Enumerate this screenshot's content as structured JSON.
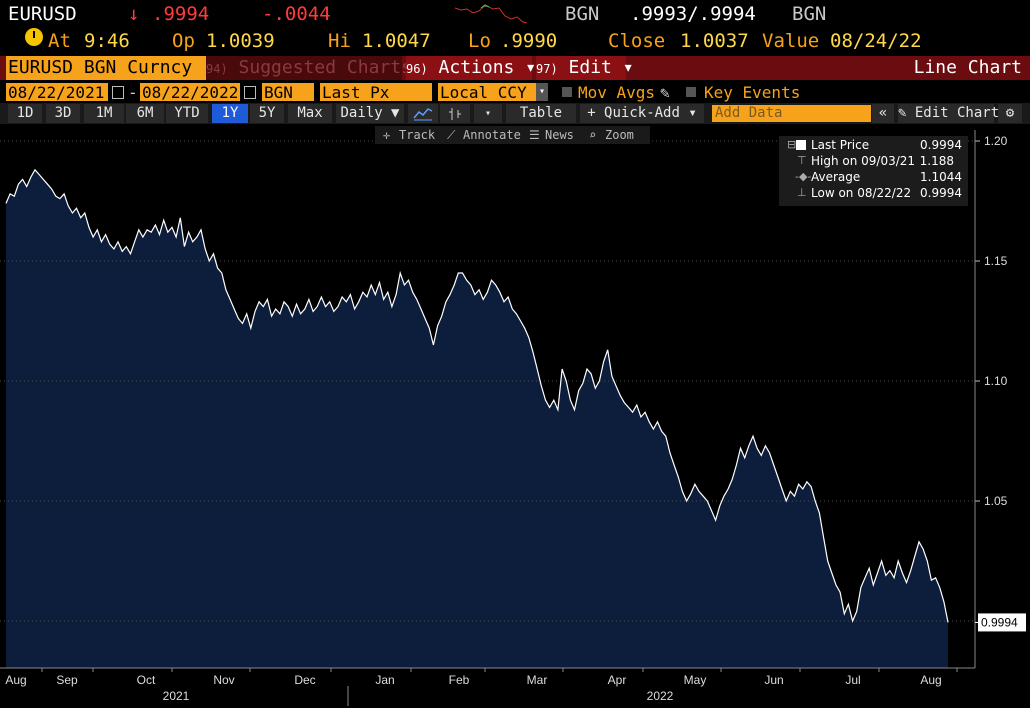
{
  "ticker": {
    "symbol": "EURUSD",
    "arrow": "↓",
    "price": ".9994",
    "change": "-.0044",
    "source": "BGN",
    "bid_ask": ".9993/.9994",
    "source2": "BGN"
  },
  "quote_line": {
    "at_label": "At",
    "time": "9:46",
    "op_label": "Op",
    "open": "1.0039",
    "hi_label": "Hi",
    "high": "1.0047",
    "lo_label": "Lo",
    "low": ".9990",
    "close_label": "Close",
    "close": "1.0037",
    "value_label": "Value",
    "value_date": "08/24/22"
  },
  "command_bar": {
    "security": "EURUSD BGN Curncy",
    "suggested_num": "94)",
    "suggested_label": "Suggested Charts",
    "actions_num": "96)",
    "actions_label": "Actions ▾",
    "edit_num": "97)",
    "edit_label": "Edit ▾",
    "chart_type": "Line Chart"
  },
  "settings": {
    "start_date": "08/22/2021",
    "dash": "-",
    "end_date": "08/22/2022",
    "source": "BGN",
    "field": "Last Px",
    "currency": "Local CCY",
    "mov_avgs": "Mov Avgs",
    "key_events": "Key Events"
  },
  "toolbar": {
    "periods": [
      "1D",
      "3D",
      "1M",
      "6M",
      "YTD",
      "1Y",
      "5Y",
      "Max"
    ],
    "selected_period": "1Y",
    "frequency": "Daily ▼",
    "table": "Table",
    "quick_add": "+ Quick-Add ▾",
    "add_data_placeholder": "Add Data",
    "collapse": "«",
    "edit_chart": "✎ Edit Chart",
    "gear": "⚙"
  },
  "chart_tools": {
    "track": "Track",
    "annotate": "Annotate",
    "news": "News",
    "zoom": "Zoom"
  },
  "legend": {
    "last_price_label": "Last Price",
    "last_price_value": "0.9994",
    "high_label": "High on 09/03/21",
    "high_value": "1.188",
    "average_label": "Average",
    "average_value": "1.1044",
    "low_label": "Low on 08/22/22",
    "low_value": "0.9994"
  },
  "chart_data": {
    "type": "area",
    "title": "",
    "xlabel": "",
    "ylabel": "",
    "ylim": [
      0.98,
      1.205
    ],
    "y_ticks": [
      "1.20",
      "1.15",
      "1.10",
      "1.05"
    ],
    "current_value_label": "0.9994",
    "x_tick_labels": [
      "Aug",
      "Sep",
      "Oct",
      "Nov",
      "Dec",
      "Jan",
      "Feb",
      "Mar",
      "Apr",
      "May",
      "Jun",
      "Jul",
      "Aug"
    ],
    "year_labels": [
      "2021",
      "2022"
    ],
    "colors": {
      "line": "#ffffff",
      "fill": "#0c1e3c",
      "grid": "#4a4a4a"
    },
    "series": [
      {
        "values": [
          1.174,
          1.178,
          1.177,
          1.182,
          1.184,
          1.181,
          1.185,
          1.188,
          1.186,
          1.184,
          1.182,
          1.18,
          1.177,
          1.176,
          1.178,
          1.173,
          1.17,
          1.172,
          1.168,
          1.17,
          1.164,
          1.16,
          1.163,
          1.158,
          1.161,
          1.157,
          1.155,
          1.158,
          1.154,
          1.156,
          1.153,
          1.158,
          1.163,
          1.16,
          1.163,
          1.162,
          1.165,
          1.161,
          1.167,
          1.162,
          1.164,
          1.16,
          1.168,
          1.156,
          1.162,
          1.158,
          1.16,
          1.163,
          1.155,
          1.15,
          1.153,
          1.147,
          1.145,
          1.138,
          1.134,
          1.13,
          1.126,
          1.124,
          1.128,
          1.122,
          1.129,
          1.133,
          1.131,
          1.134,
          1.127,
          1.13,
          1.128,
          1.133,
          1.131,
          1.127,
          1.132,
          1.128,
          1.13,
          1.134,
          1.129,
          1.131,
          1.135,
          1.131,
          1.133,
          1.129,
          1.131,
          1.135,
          1.133,
          1.136,
          1.13,
          1.133,
          1.137,
          1.135,
          1.14,
          1.136,
          1.141,
          1.134,
          1.137,
          1.131,
          1.136,
          1.145,
          1.14,
          1.142,
          1.137,
          1.134,
          1.13,
          1.126,
          1.122,
          1.115,
          1.123,
          1.127,
          1.133,
          1.136,
          1.14,
          1.145,
          1.145,
          1.142,
          1.14,
          1.136,
          1.138,
          1.134,
          1.137,
          1.142,
          1.14,
          1.137,
          1.133,
          1.135,
          1.13,
          1.128,
          1.125,
          1.122,
          1.118,
          1.112,
          1.105,
          1.098,
          1.092,
          1.089,
          1.092,
          1.088,
          1.105,
          1.1,
          1.092,
          1.088,
          1.096,
          1.099,
          1.105,
          1.103,
          1.097,
          1.1,
          1.108,
          1.113,
          1.102,
          1.098,
          1.094,
          1.091,
          1.089,
          1.087,
          1.09,
          1.085,
          1.087,
          1.083,
          1.08,
          1.083,
          1.079,
          1.077,
          1.07,
          1.065,
          1.06,
          1.054,
          1.05,
          1.053,
          1.057,
          1.054,
          1.052,
          1.05,
          1.046,
          1.042,
          1.048,
          1.052,
          1.055,
          1.059,
          1.065,
          1.072,
          1.068,
          1.073,
          1.077,
          1.072,
          1.069,
          1.073,
          1.07,
          1.065,
          1.06,
          1.055,
          1.05,
          1.054,
          1.052,
          1.057,
          1.055,
          1.058,
          1.056,
          1.05,
          1.045,
          1.035,
          1.025,
          1.02,
          1.015,
          1.012,
          1.003,
          1.007,
          1.0,
          1.004,
          1.014,
          1.018,
          1.022,
          1.015,
          1.02,
          1.025,
          1.019,
          1.021,
          1.018,
          1.025,
          1.02,
          1.016,
          1.021,
          1.027,
          1.033,
          1.03,
          1.025,
          1.017,
          1.018,
          1.014,
          1.008,
          0.9994
        ]
      }
    ]
  }
}
